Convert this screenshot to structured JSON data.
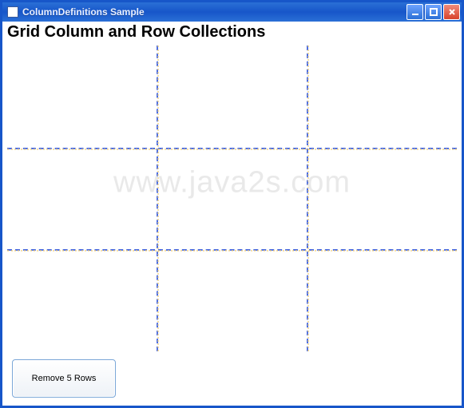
{
  "window": {
    "title": "ColumnDefinitions Sample"
  },
  "heading": "Grid Column and Row Collections",
  "grid": {
    "columns": 3,
    "rows": 3
  },
  "button": {
    "label": "Remove 5 Rows"
  },
  "watermark": "www.java2s.com"
}
